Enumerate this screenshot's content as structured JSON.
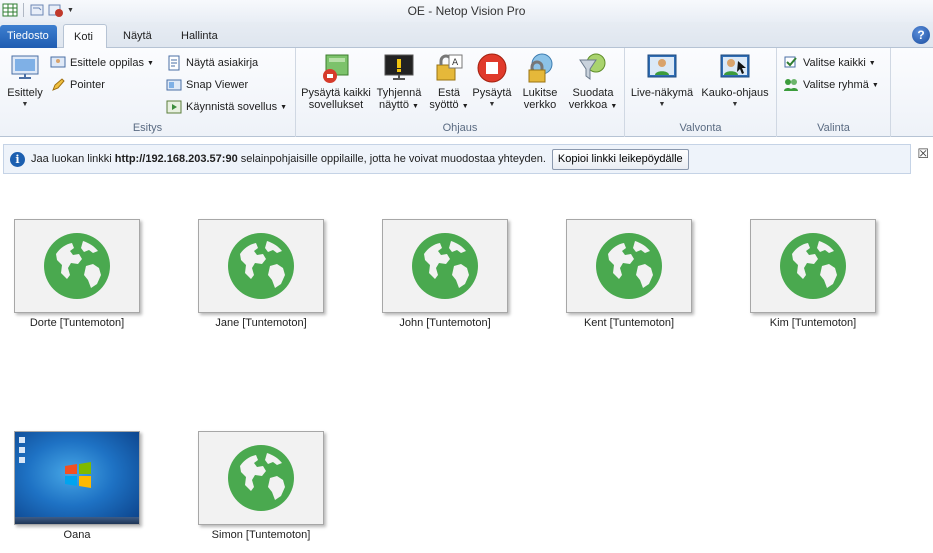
{
  "window": {
    "title": "OE - Netop Vision Pro"
  },
  "quick_access": {
    "icons": [
      "spreadsheet-icon",
      "undo-icon",
      "settings-icon"
    ]
  },
  "tabs": [
    {
      "label": "Tiedosto"
    },
    {
      "label": "Koti"
    },
    {
      "label": "Näytä"
    },
    {
      "label": "Hallinta"
    }
  ],
  "active_tab": "Koti",
  "ribbon": {
    "esitys": {
      "label": "Esitys",
      "esittely": "Esittely",
      "esittele_oppilas": "Esittele oppilas",
      "pointer": "Pointer",
      "nayta_asiakirja": "Näytä asiakirja",
      "snap_viewer": "Snap Viewer",
      "kaynnista_sovellus": "Käynnistä sovellus"
    },
    "ohjaus": {
      "label": "Ohjaus",
      "pysayta_kaikki": [
        "Pysäytä kaikki",
        "sovellukset"
      ],
      "tyhjenna": [
        "Tyhjennä",
        "näyttö"
      ],
      "esta": [
        "Estä",
        "syöttö"
      ],
      "pysayta": [
        "Pysäytä",
        ""
      ],
      "lukitse": [
        "Lukitse",
        "verkko"
      ],
      "suodata": [
        "Suodata",
        "verkkoa"
      ]
    },
    "valvonta": {
      "label": "Valvonta",
      "live": "Live-näkymä",
      "kauko": "Kauko-ohjaus"
    },
    "valinta": {
      "label": "Valinta",
      "valitse_kaikki": "Valitse kaikki",
      "valitse_ryhma": "Valitse ryhmä"
    }
  },
  "infobar": {
    "prefix": "Jaa luokan linkki ",
    "url": "http://192.168.203.57:90",
    "suffix": " selainpohjaisille oppilaille, jotta he voivat muodostaa yhteyden.",
    "button": "Kopioi linkki leikepöydälle",
    "close": "☒"
  },
  "students": [
    {
      "name": "Dorte [Tuntemoton]",
      "type": "web"
    },
    {
      "name": "Jane [Tuntemoton]",
      "type": "web"
    },
    {
      "name": "John [Tuntemoton]",
      "type": "web"
    },
    {
      "name": "Kent [Tuntemoton]",
      "type": "web"
    },
    {
      "name": "Kim [Tuntemoton]",
      "type": "web"
    },
    {
      "name": "Oana",
      "type": "desktop"
    },
    {
      "name": "Simon [Tuntemoton]",
      "type": "web"
    }
  ],
  "colors": {
    "globe": "#4aa94f",
    "accent": "#1f5cb1",
    "thumb_bg": "#f2f2f2"
  }
}
